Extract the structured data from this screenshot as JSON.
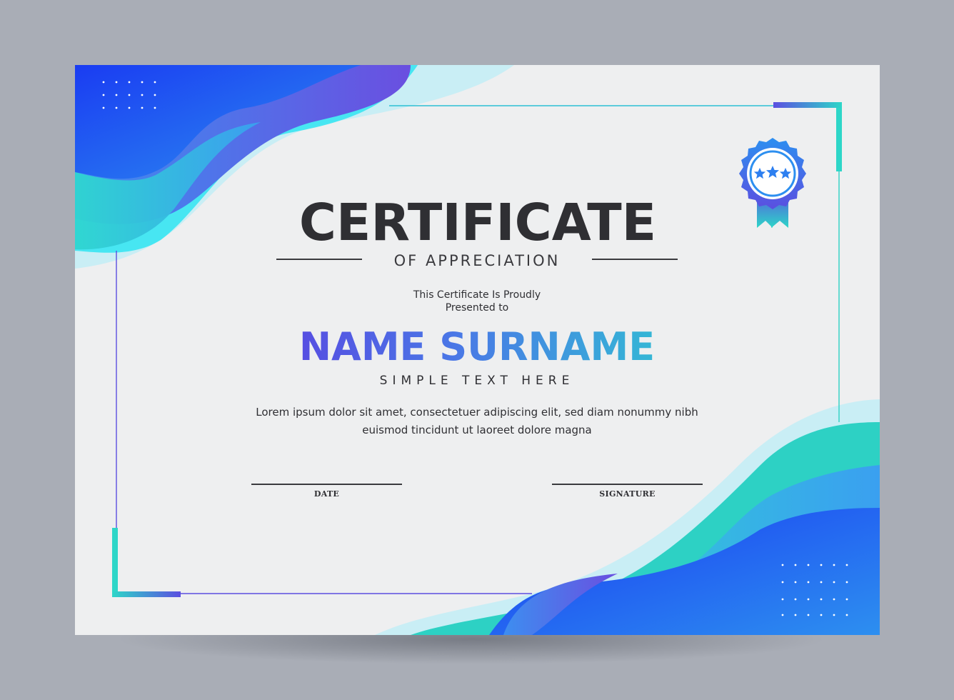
{
  "certificate": {
    "title": "CERTIFICATE",
    "subtitle": "OF APPRECIATION",
    "presented_line1": "This Certificate Is Proudly",
    "presented_line2": "Presented to",
    "recipient_name": "NAME SURNAME",
    "tagline": "SIMPLE TEXT HERE",
    "body_line1": "Lorem ipsum dolor sit amet, consectetuer adipiscing elit, sed diam nonummy nibh",
    "body_line2": "euismod tincidunt ut laoreet dolore magna",
    "date_label": "DATE",
    "signature_label": "SIGNATURE"
  },
  "badge": {
    "icon": "award-ribbon-icon",
    "stars": 3
  },
  "colors": {
    "background": "#a9adb6",
    "paper": "#eeeff0",
    "deep_blue": "#1633f0",
    "cyan": "#35e6f0",
    "teal": "#2dd1c4",
    "violet": "#5b3fe0",
    "text_dark": "#2f2f33"
  }
}
